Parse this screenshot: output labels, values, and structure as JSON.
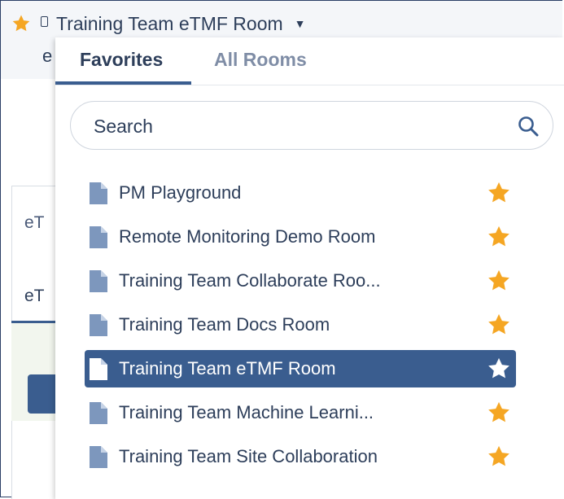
{
  "header": {
    "title": "Training Team eTMF Room",
    "subtitle_partial": "e"
  },
  "background": {
    "card_label": "eT",
    "tab_label": "eT"
  },
  "dropdown": {
    "tabs": [
      {
        "label": "Favorites",
        "active": true
      },
      {
        "label": "All Rooms",
        "active": false
      }
    ],
    "search": {
      "placeholder": "Search",
      "value": ""
    },
    "rooms": [
      {
        "name": "PM Playground",
        "favorite": true,
        "selected": false
      },
      {
        "name": "Remote Monitoring Demo Room",
        "favorite": true,
        "selected": false
      },
      {
        "name": "Training Team Collaborate Roo...",
        "favorite": true,
        "selected": false
      },
      {
        "name": "Training Team Docs Room",
        "favorite": true,
        "selected": false
      },
      {
        "name": "Training Team eTMF Room",
        "favorite": true,
        "selected": true
      },
      {
        "name": "Training Team Machine Learni...",
        "favorite": true,
        "selected": false
      },
      {
        "name": "Training Team Site Collaboration",
        "favorite": true,
        "selected": false
      }
    ]
  },
  "colors": {
    "accent": "#3a5d8f",
    "star": "#f5a623",
    "star_selected": "#ffffff",
    "doc_icon": "#7d97bd",
    "text": "#2d3e5a"
  }
}
